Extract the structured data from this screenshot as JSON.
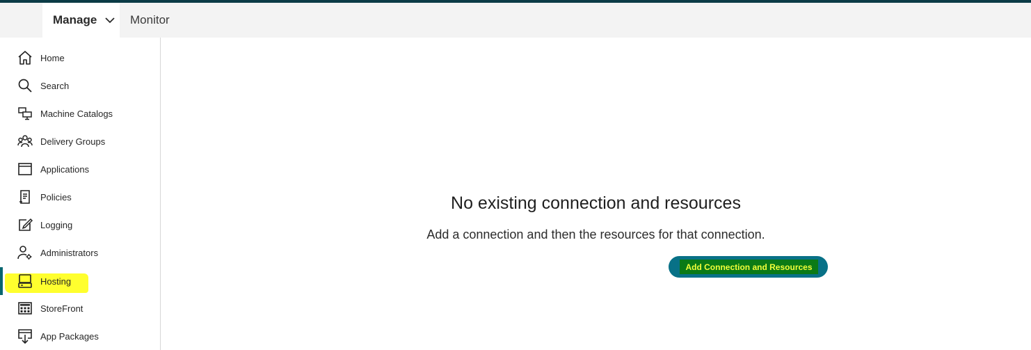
{
  "topbar": {
    "manage_label": "Manage",
    "monitor_label": "Monitor"
  },
  "sidebar": {
    "items": [
      {
        "label": "Home",
        "icon": "home-icon"
      },
      {
        "label": "Search",
        "icon": "search-icon"
      },
      {
        "label": "Machine Catalogs",
        "icon": "machine-catalogs-icon"
      },
      {
        "label": "Delivery Groups",
        "icon": "delivery-groups-icon"
      },
      {
        "label": "Applications",
        "icon": "applications-icon"
      },
      {
        "label": "Policies",
        "icon": "policies-icon"
      },
      {
        "label": "Logging",
        "icon": "logging-icon"
      },
      {
        "label": "Administrators",
        "icon": "administrators-icon"
      },
      {
        "label": "Hosting",
        "icon": "hosting-icon",
        "selected": true
      },
      {
        "label": "StoreFront",
        "icon": "storefront-icon"
      },
      {
        "label": "App Packages",
        "icon": "app-packages-icon"
      }
    ]
  },
  "main": {
    "empty_title": "No existing connection and resources",
    "empty_subtitle": "Add a connection and then the resources for that connection.",
    "add_button_label": "Add Connection and Resources"
  },
  "colors": {
    "accent": "#08666f",
    "button": "#087187",
    "highlight": "#ffff2e",
    "top_strip": "#0b3b46"
  }
}
